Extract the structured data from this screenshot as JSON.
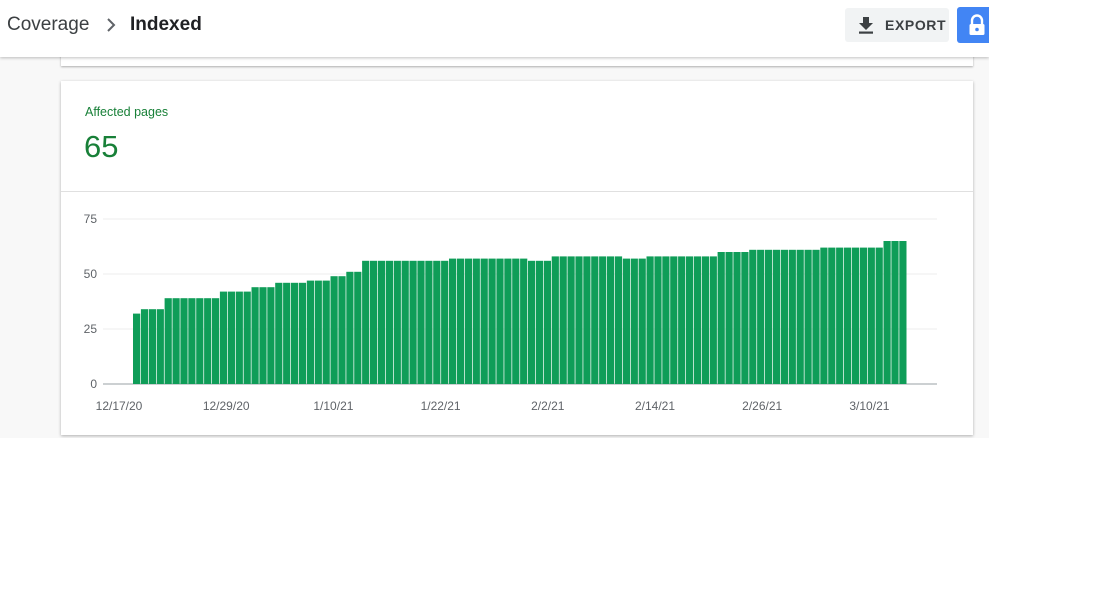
{
  "breadcrumb": {
    "root": "Coverage",
    "current": "Indexed"
  },
  "toolbar": {
    "export_label": "EXPORT"
  },
  "metric": {
    "label": "Affected pages",
    "value": "65"
  },
  "colors": {
    "bar": "#0f9d58",
    "accent": "#188038",
    "lock_button": "#4285f4"
  },
  "icons": {
    "separator": "chevron-right-icon",
    "export": "download-icon",
    "lock": "lock-icon"
  },
  "chart_data": {
    "type": "bar",
    "ylim": [
      0,
      75
    ],
    "y_ticks": [
      0,
      25,
      50,
      75
    ],
    "x_tick_labels": [
      "12/17/20",
      "12/29/20",
      "1/10/21",
      "1/22/21",
      "2/2/21",
      "2/14/21",
      "2/26/21",
      "3/10/21"
    ],
    "grid": true,
    "series": [
      {
        "values": [
          32,
          34,
          34,
          34,
          39,
          39,
          39,
          39,
          39,
          39,
          39,
          42,
          42,
          42,
          42,
          44,
          44,
          44,
          46,
          46,
          46,
          46,
          47,
          47,
          47,
          49,
          49,
          51,
          51,
          56,
          56,
          56,
          56,
          56,
          56,
          56,
          56,
          56,
          56,
          56,
          57,
          57,
          57,
          57,
          57,
          57,
          57,
          57,
          57,
          57,
          56,
          56,
          56,
          58,
          58,
          58,
          58,
          58,
          58,
          58,
          58,
          58,
          57,
          57,
          57,
          58,
          58,
          58,
          58,
          58,
          58,
          58,
          58,
          58,
          60,
          60,
          60,
          60,
          61,
          61,
          61,
          61,
          61,
          61,
          61,
          61,
          61,
          62,
          62,
          62,
          62,
          62,
          62,
          62,
          62,
          65,
          65,
          65
        ]
      }
    ]
  }
}
